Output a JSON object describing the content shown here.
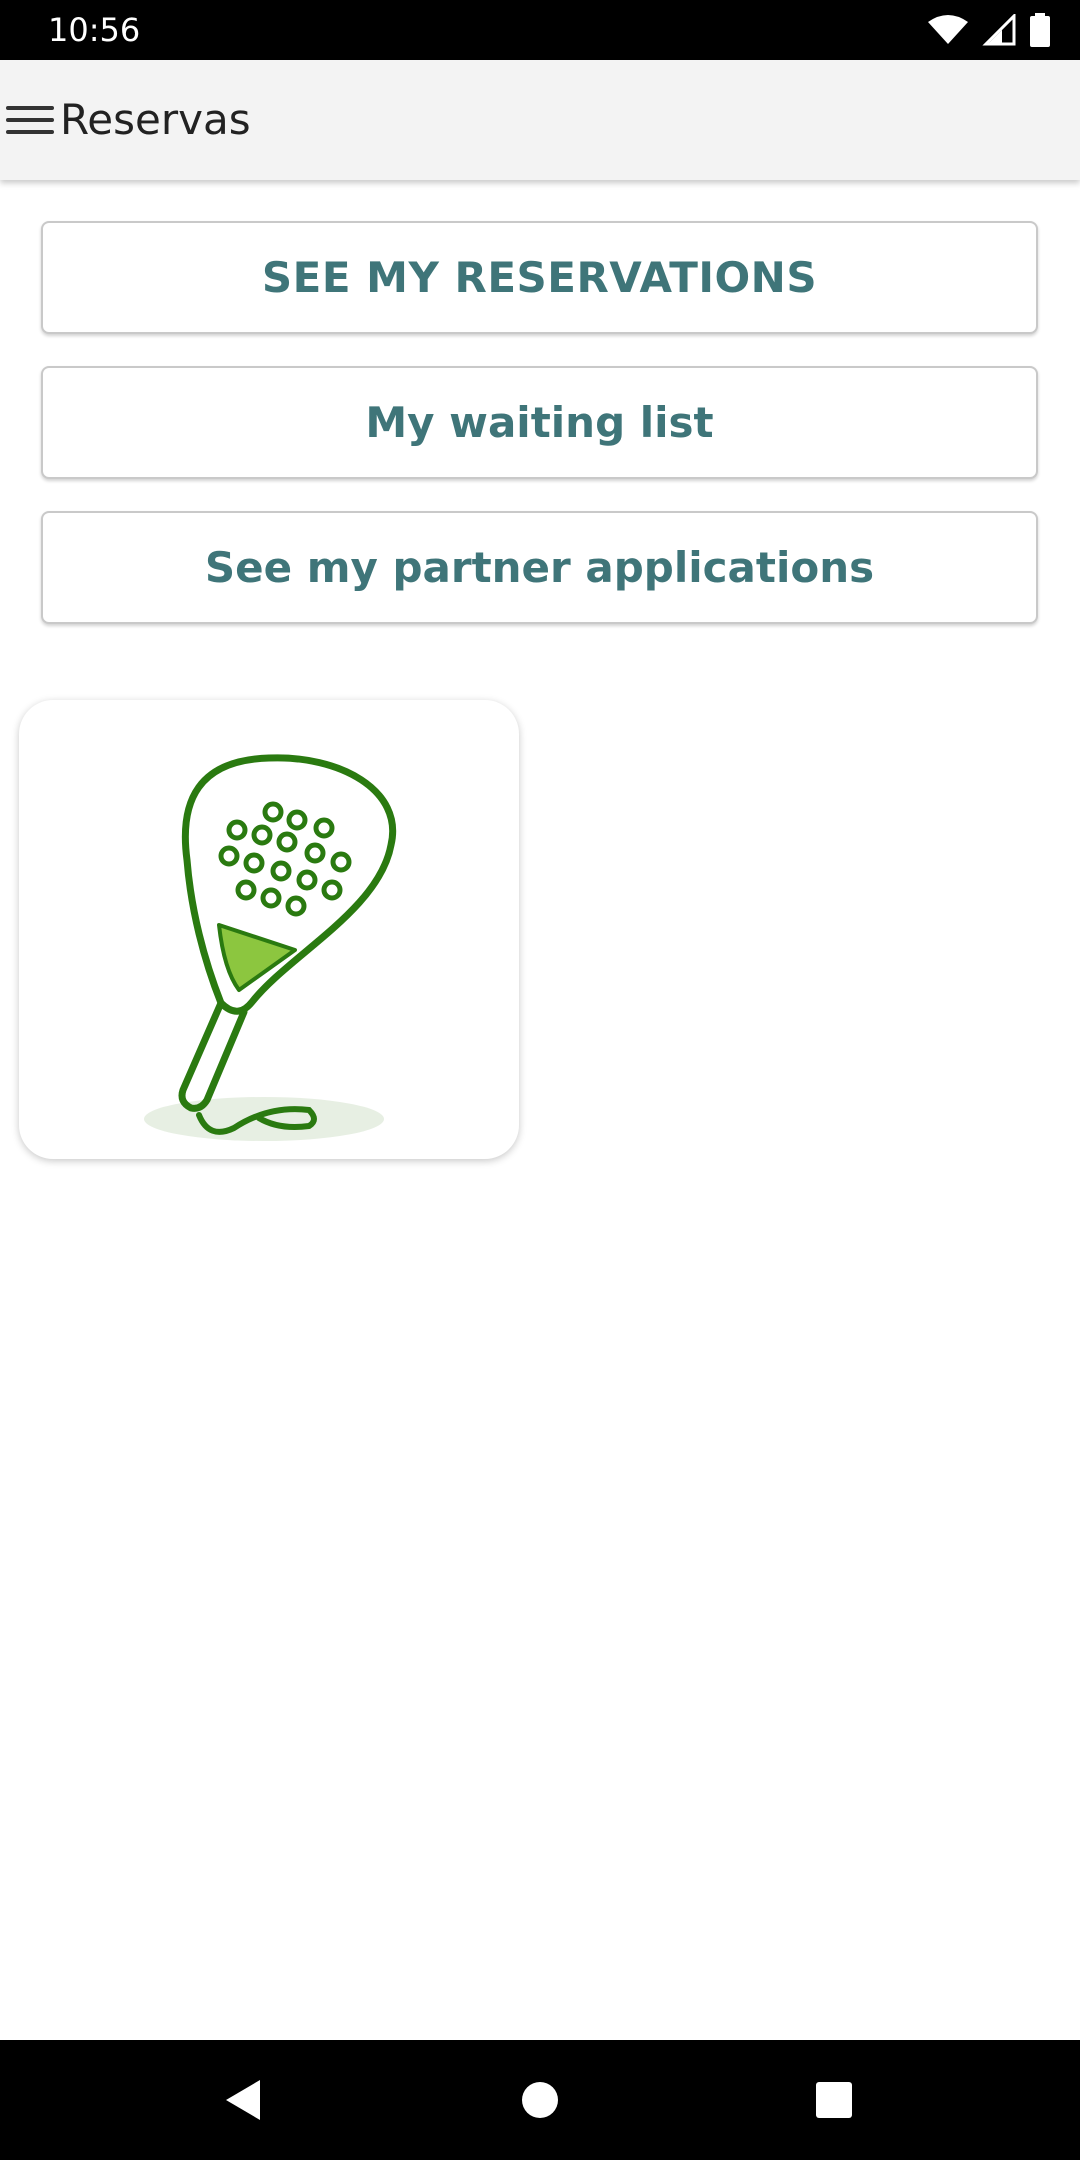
{
  "status_bar": {
    "time": "10:56",
    "icons": [
      "wifi-icon",
      "cellular-signal-icon",
      "battery-icon"
    ],
    "background": "#000000"
  },
  "app_bar": {
    "title": "Reservas",
    "menu_icon": "hamburger-menu-icon",
    "background": "#f3f3f3"
  },
  "actions": [
    {
      "label": "SEE MY RESERVATIONS"
    },
    {
      "label": "My waiting list"
    },
    {
      "label": "See my partner applications"
    }
  ],
  "colors": {
    "button_text": "#3f7579",
    "icon_green": "#2a7a10",
    "icon_accent": "#8cc63f"
  },
  "sport_tiles": [
    {
      "icon": "padel-racket-icon"
    }
  ],
  "nav_bar": {
    "buttons": [
      "back-icon",
      "home-icon",
      "recents-icon"
    ]
  }
}
